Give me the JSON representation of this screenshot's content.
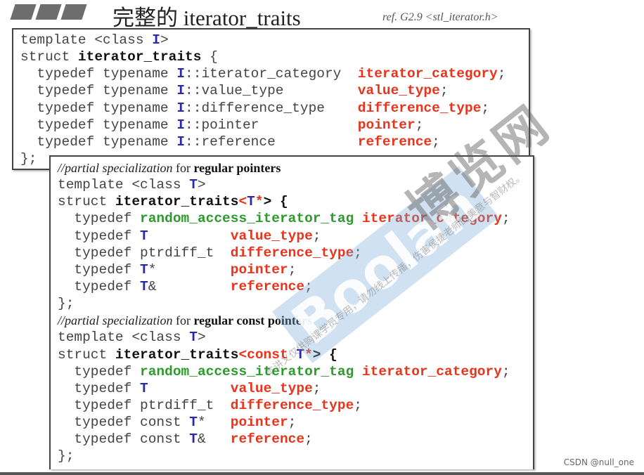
{
  "header": {
    "title": "完整的 iterator_traits",
    "ref": "ref. G2.9  <stl_iterator.h>"
  },
  "colors": {
    "type_param": "#2a2aa8",
    "member": "#e8341c",
    "tag": "#2c9a2c",
    "text": "#444444"
  },
  "primary_template": {
    "lines": [
      [
        [
          "template <class ",
          "n"
        ],
        [
          "I",
          "I"
        ],
        [
          ">",
          "n"
        ]
      ],
      [
        [
          "struct ",
          "n"
        ],
        [
          "iterator_traits",
          "b"
        ],
        [
          " {",
          "n"
        ]
      ],
      [
        [
          "  typedef typename ",
          "n"
        ],
        [
          "I",
          "I"
        ],
        [
          "::iterator_category  ",
          "n"
        ],
        [
          "iterator_category",
          "r"
        ],
        [
          ";",
          "n"
        ]
      ],
      [
        [
          "  typedef typename ",
          "n"
        ],
        [
          "I",
          "I"
        ],
        [
          "::value_type         ",
          "n"
        ],
        [
          "value_type",
          "r"
        ],
        [
          ";",
          "n"
        ]
      ],
      [
        [
          "  typedef typename ",
          "n"
        ],
        [
          "I",
          "I"
        ],
        [
          "::difference_type    ",
          "n"
        ],
        [
          "difference_type",
          "r"
        ],
        [
          ";",
          "n"
        ]
      ],
      [
        [
          "  typedef typename ",
          "n"
        ],
        [
          "I",
          "I"
        ],
        [
          "::pointer            ",
          "n"
        ],
        [
          "pointer",
          "r"
        ],
        [
          ";",
          "n"
        ]
      ],
      [
        [
          "  typedef typename ",
          "n"
        ],
        [
          "I",
          "I"
        ],
        [
          "::reference          ",
          "n"
        ],
        [
          "reference",
          "r"
        ],
        [
          ";",
          "n"
        ]
      ],
      [
        [
          "};",
          "n"
        ]
      ]
    ]
  },
  "specializations": {
    "lines": [
      [
        [
          "//partial specialization",
          "c"
        ],
        [
          " for ",
          "cn"
        ],
        [
          "regular pointers",
          "cb"
        ]
      ],
      [
        [
          "template <class ",
          "n"
        ],
        [
          "T",
          "I"
        ],
        [
          ">",
          "n"
        ]
      ],
      [
        [
          "struct ",
          "n"
        ],
        [
          "iterator_traits",
          "b"
        ],
        [
          "<",
          "r"
        ],
        [
          "T",
          "I"
        ],
        [
          "*",
          "r"
        ],
        [
          "> {",
          "b"
        ]
      ],
      [
        [
          "  typedef ",
          "n"
        ],
        [
          "random_access_iterator_tag",
          "g"
        ],
        [
          " ",
          "n"
        ],
        [
          "iterator_category",
          "r"
        ],
        [
          ";",
          "n"
        ]
      ],
      [
        [
          "  typedef ",
          "n"
        ],
        [
          "T",
          "I"
        ],
        [
          "          ",
          "n"
        ],
        [
          "value_type",
          "r"
        ],
        [
          ";",
          "n"
        ]
      ],
      [
        [
          "  typedef ptrdiff_t  ",
          "n"
        ],
        [
          "difference_type",
          "r"
        ],
        [
          ";",
          "n"
        ]
      ],
      [
        [
          "  typedef ",
          "n"
        ],
        [
          "T",
          "I"
        ],
        [
          "*         ",
          "n"
        ],
        [
          "pointer",
          "r"
        ],
        [
          ";",
          "n"
        ]
      ],
      [
        [
          "  typedef ",
          "n"
        ],
        [
          "T",
          "I"
        ],
        [
          "&         ",
          "n"
        ],
        [
          "reference",
          "r"
        ],
        [
          ";",
          "n"
        ]
      ],
      [
        [
          "};",
          "n"
        ]
      ],
      [
        [
          "//partial specialization",
          "c"
        ],
        [
          " for ",
          "cn"
        ],
        [
          "regular const pointers",
          "cb"
        ]
      ],
      [
        [
          "template <class ",
          "n"
        ],
        [
          "T",
          "I"
        ],
        [
          ">",
          "n"
        ]
      ],
      [
        [
          "struct ",
          "n"
        ],
        [
          "iterator_traits",
          "b"
        ],
        [
          "<const ",
          "r"
        ],
        [
          "T",
          "I"
        ],
        [
          "*",
          "r"
        ],
        [
          "> {",
          "b"
        ]
      ],
      [
        [
          "  typedef ",
          "n"
        ],
        [
          "random_access_iterator_tag",
          "g"
        ],
        [
          " ",
          "n"
        ],
        [
          "iterator_category",
          "r"
        ],
        [
          ";",
          "n"
        ]
      ],
      [
        [
          "  typedef ",
          "n"
        ],
        [
          "T",
          "I"
        ],
        [
          "          ",
          "n"
        ],
        [
          "value_type",
          "r"
        ],
        [
          ";",
          "n"
        ]
      ],
      [
        [
          "  typedef ptrdiff_t  ",
          "n"
        ],
        [
          "difference_type",
          "r"
        ],
        [
          ";",
          "n"
        ]
      ],
      [
        [
          "  typedef const ",
          "n"
        ],
        [
          "T",
          "I"
        ],
        [
          "*   ",
          "n"
        ],
        [
          "pointer",
          "r"
        ],
        [
          ";",
          "n"
        ]
      ],
      [
        [
          "  typedef const ",
          "n"
        ],
        [
          "T",
          "I"
        ],
        [
          "&   ",
          "n"
        ],
        [
          "reference",
          "r"
        ],
        [
          ";",
          "n"
        ]
      ],
      [
        [
          "};",
          "n"
        ]
      ]
    ]
  },
  "watermark": {
    "brand_cn": "博览网",
    "brand_en": "Boolan",
    "notice": "本讲义仅供购课学员专用，请勿线上传播，伤害侯捷老师的美意与智财权。"
  },
  "footer": {
    "credit": "CSDN @null_one"
  }
}
